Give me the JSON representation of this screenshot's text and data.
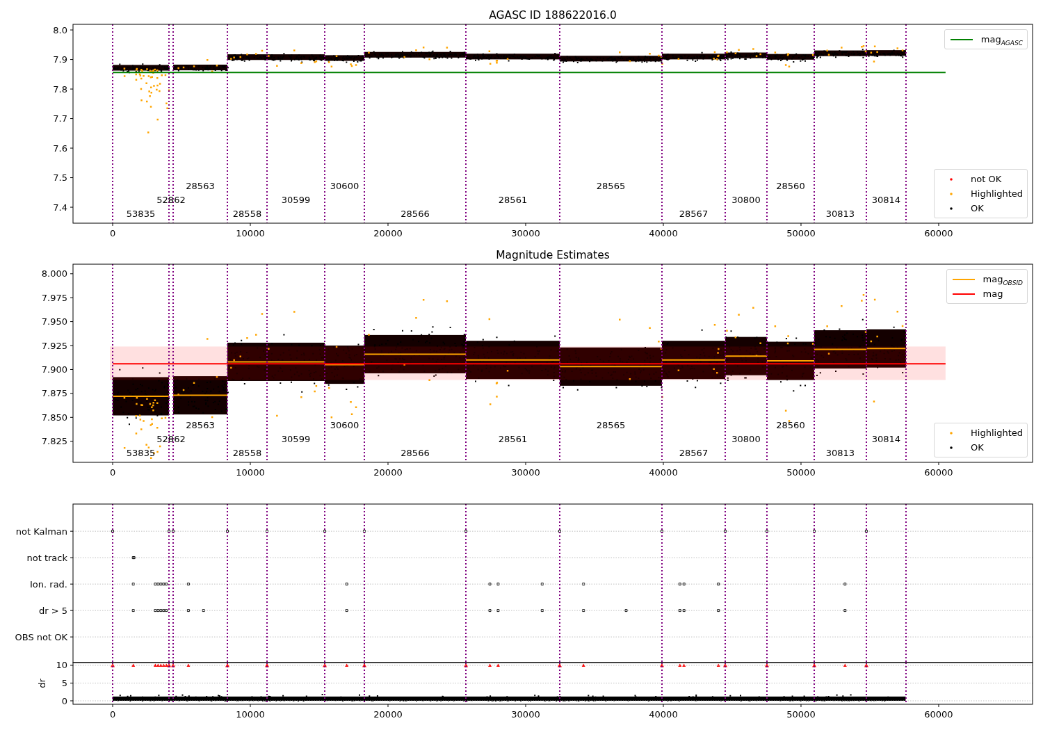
{
  "panels": [
    {
      "chart_data": {
        "type": "line",
        "title": "AGASC ID 188622016.0",
        "legend": "upper right",
        "xlim": [
          -2880,
          66820
        ],
        "ylim": [
          7.346,
          8.019
        ],
        "xticks": [
          0,
          10000,
          20000,
          30000,
          40000,
          50000,
          60000
        ],
        "yticks": [
          {
            "value": 7.4,
            "label": "7.4"
          },
          {
            "value": 7.5,
            "label": "7.5"
          },
          {
            "value": 7.6,
            "label": "7.6"
          },
          {
            "value": 7.7,
            "label": "7.7"
          },
          {
            "value": 7.8,
            "label": "7.8"
          },
          {
            "value": 7.9,
            "label": "7.9"
          },
          {
            "value": 8.0,
            "label": "8.0"
          }
        ],
        "series": [
          {
            "name": "mag$_{AGASC}$",
            "color": "#008000",
            "x": [
              0,
              60500
            ],
            "values": [
              7.856,
              7.856
            ]
          }
        ],
        "ref_lines": [
          {
            "axis": "x",
            "value": 0
          },
          {
            "axis": "x",
            "value": 4091
          },
          {
            "axis": "x",
            "value": 4394
          },
          {
            "axis": "x",
            "value": 8333
          },
          {
            "axis": "x",
            "value": 11212
          },
          {
            "axis": "x",
            "value": 15404
          },
          {
            "axis": "x",
            "value": 18283
          },
          {
            "axis": "x",
            "value": 25657
          },
          {
            "axis": "x",
            "value": 32475
          },
          {
            "axis": "x",
            "value": 39899
          },
          {
            "axis": "x",
            "value": 44495
          },
          {
            "axis": "x",
            "value": 47525
          },
          {
            "axis": "x",
            "value": 50960
          },
          {
            "axis": "x",
            "value": 54747
          },
          {
            "axis": "x",
            "value": 57626
          }
        ],
        "annotations": [
          "53835",
          "52862",
          "28563",
          "28558",
          "30599",
          "30600",
          "28566",
          "28561",
          "28565",
          "28567",
          "30800",
          "28560",
          "30813",
          "30814"
        ]
      },
      "points": {
        "kind": "mag"
      },
      "markers_legend": [
        {
          "label": "not OK",
          "color": "#ff0000"
        },
        {
          "label": "Highlighted",
          "color": "#ffa500"
        },
        {
          "label": "OK",
          "color": "#000000"
        }
      ]
    },
    {
      "chart_data": {
        "type": "line",
        "title": "Magnitude Estimates",
        "legend": "upper right",
        "xlim": [
          -2880,
          66820
        ],
        "ylim": [
          7.803,
          8.01
        ],
        "xticks": [
          0,
          10000,
          20000,
          30000,
          40000,
          50000,
          60000
        ],
        "yticks": [
          {
            "value": 7.825,
            "label": "7.825"
          },
          {
            "value": 7.85,
            "label": "7.850"
          },
          {
            "value": 7.875,
            "label": "7.875"
          },
          {
            "value": 7.9,
            "label": "7.900"
          },
          {
            "value": 7.925,
            "label": "7.925"
          },
          {
            "value": 7.95,
            "label": "7.950"
          },
          {
            "value": 7.975,
            "label": "7.975"
          },
          {
            "value": 8.0,
            "label": "8.000"
          }
        ],
        "series": [
          {
            "name": "mag$_{OBSID}$",
            "color": "#ffa500",
            "x": [
              0,
              4091,
              4394,
              8333,
              8333,
              11212,
              11212,
              15404,
              15404,
              18283,
              18283,
              25657,
              25657,
              32475,
              32475,
              39899,
              39899,
              44495,
              44495,
              47525,
              47525,
              50960,
              50960,
              54747,
              54747,
              57626
            ],
            "values": [
              7.872,
              7.872,
              7.873,
              7.873,
              7.908,
              7.908,
              7.908,
              7.908,
              7.905,
              7.905,
              7.916,
              7.916,
              7.91,
              7.91,
              7.903,
              7.903,
              7.91,
              7.91,
              7.914,
              7.914,
              7.909,
              7.909,
              7.921,
              7.921,
              7.922,
              7.922
            ]
          },
          {
            "name": "mag",
            "color": "#ff0000",
            "x": [
              0,
              60500
            ],
            "values": [
              7.906,
              7.906
            ]
          }
        ],
        "bands": [
          {
            "axis": "y",
            "from": 7.889,
            "to": 7.924,
            "color": "#ff0000"
          }
        ],
        "ref_lines": [
          {
            "axis": "x",
            "value": 0
          },
          {
            "axis": "x",
            "value": 4091
          },
          {
            "axis": "x",
            "value": 4394
          },
          {
            "axis": "x",
            "value": 8333
          },
          {
            "axis": "x",
            "value": 11212
          },
          {
            "axis": "x",
            "value": 15404
          },
          {
            "axis": "x",
            "value": 18283
          },
          {
            "axis": "x",
            "value": 25657
          },
          {
            "axis": "x",
            "value": 32475
          },
          {
            "axis": "x",
            "value": 39899
          },
          {
            "axis": "x",
            "value": 44495
          },
          {
            "axis": "x",
            "value": 47525
          },
          {
            "axis": "x",
            "value": 50960
          },
          {
            "axis": "x",
            "value": 54747
          },
          {
            "axis": "x",
            "value": 57626
          }
        ],
        "annotations": [
          "53835",
          "52862",
          "28563",
          "28558",
          "30599",
          "30600",
          "28566",
          "28561",
          "28565",
          "28567",
          "30800",
          "28560",
          "30813",
          "30814"
        ]
      },
      "points": {
        "kind": "mag"
      },
      "markers_legend": [
        {
          "label": "Highlighted",
          "color": "#ffa500"
        },
        {
          "label": "OK",
          "color": "#000000"
        }
      ]
    },
    {
      "chart_data": {
        "type": "scatter",
        "orientation": "horizontal",
        "grid": true,
        "xlim": [
          -2880,
          66820
        ],
        "categories": [
          "not Kalman",
          "not track",
          "Ion. rad.",
          "dr > 5",
          "OBS not OK"
        ],
        "ref_lines": [
          {
            "axis": "x",
            "value": 0
          },
          {
            "axis": "x",
            "value": 4091
          },
          {
            "axis": "x",
            "value": 4394
          },
          {
            "axis": "x",
            "value": 8333
          },
          {
            "axis": "x",
            "value": 11212
          },
          {
            "axis": "x",
            "value": 15404
          },
          {
            "axis": "x",
            "value": 18283
          },
          {
            "axis": "x",
            "value": 25657
          },
          {
            "axis": "x",
            "value": 32475
          },
          {
            "axis": "x",
            "value": 39899
          },
          {
            "axis": "x",
            "value": 44495
          },
          {
            "axis": "x",
            "value": 47525
          },
          {
            "axis": "x",
            "value": 50960
          },
          {
            "axis": "x",
            "value": 54747
          },
          {
            "axis": "x",
            "value": 57626
          }
        ]
      },
      "points": {
        "kind": "flags"
      }
    },
    {
      "chart_data": {
        "type": "scatter",
        "ylabel": "dr",
        "grid": true,
        "xlim": [
          -2880,
          66820
        ],
        "ylim": [
          -0.98,
          10.78
        ],
        "xticks": [
          0,
          10000,
          20000,
          30000,
          40000,
          50000,
          60000
        ],
        "yticks": [
          0,
          5,
          10
        ],
        "ref_lines": [
          {
            "axis": "x",
            "value": 0
          },
          {
            "axis": "x",
            "value": 4091
          },
          {
            "axis": "x",
            "value": 4394
          },
          {
            "axis": "x",
            "value": 8333
          },
          {
            "axis": "x",
            "value": 11212
          },
          {
            "axis": "x",
            "value": 15404
          },
          {
            "axis": "x",
            "value": 18283
          },
          {
            "axis": "x",
            "value": 25657
          },
          {
            "axis": "x",
            "value": 32475
          },
          {
            "axis": "x",
            "value": 39899
          },
          {
            "axis": "x",
            "value": 44495
          },
          {
            "axis": "x",
            "value": 47525
          },
          {
            "axis": "x",
            "value": 50960
          },
          {
            "axis": "x",
            "value": 54747
          },
          {
            "axis": "x",
            "value": 57626
          }
        ]
      },
      "points": {
        "kind": "dr"
      }
    }
  ]
}
